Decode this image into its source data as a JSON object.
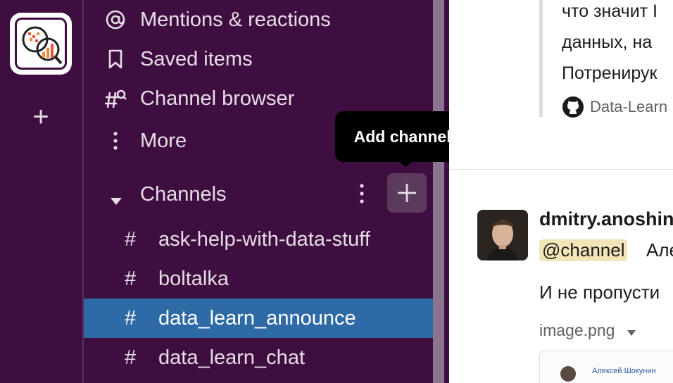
{
  "nav": {
    "mentions": "Mentions & reactions",
    "saved": "Saved items",
    "browser": "Channel browser",
    "more": "More"
  },
  "section": {
    "label": "Channels"
  },
  "tooltip": "Add channels",
  "channels": [
    {
      "hash": "#",
      "name": "ask-help-with-data-stuff"
    },
    {
      "hash": "#",
      "name": "boltalka"
    },
    {
      "hash": "#",
      "name": "data_learn_announce"
    },
    {
      "hash": "#",
      "name": "data_learn_chat"
    }
  ],
  "main": {
    "quote_lines": [
      "что значит I",
      "данных, на",
      "Потренирук"
    ],
    "github_source": "Data-Learn",
    "author": "dmitry.anoshin",
    "mention": "@channel",
    "after_mention": "Але",
    "message": "И не пропусти",
    "file_name": "image.png",
    "thumb_caption": "Алексей Шокунин"
  },
  "colors": {
    "sidebar_bg": "#3f0e40",
    "active_channel": "#2e6aa5",
    "mention_bg": "#f2e5b8"
  }
}
